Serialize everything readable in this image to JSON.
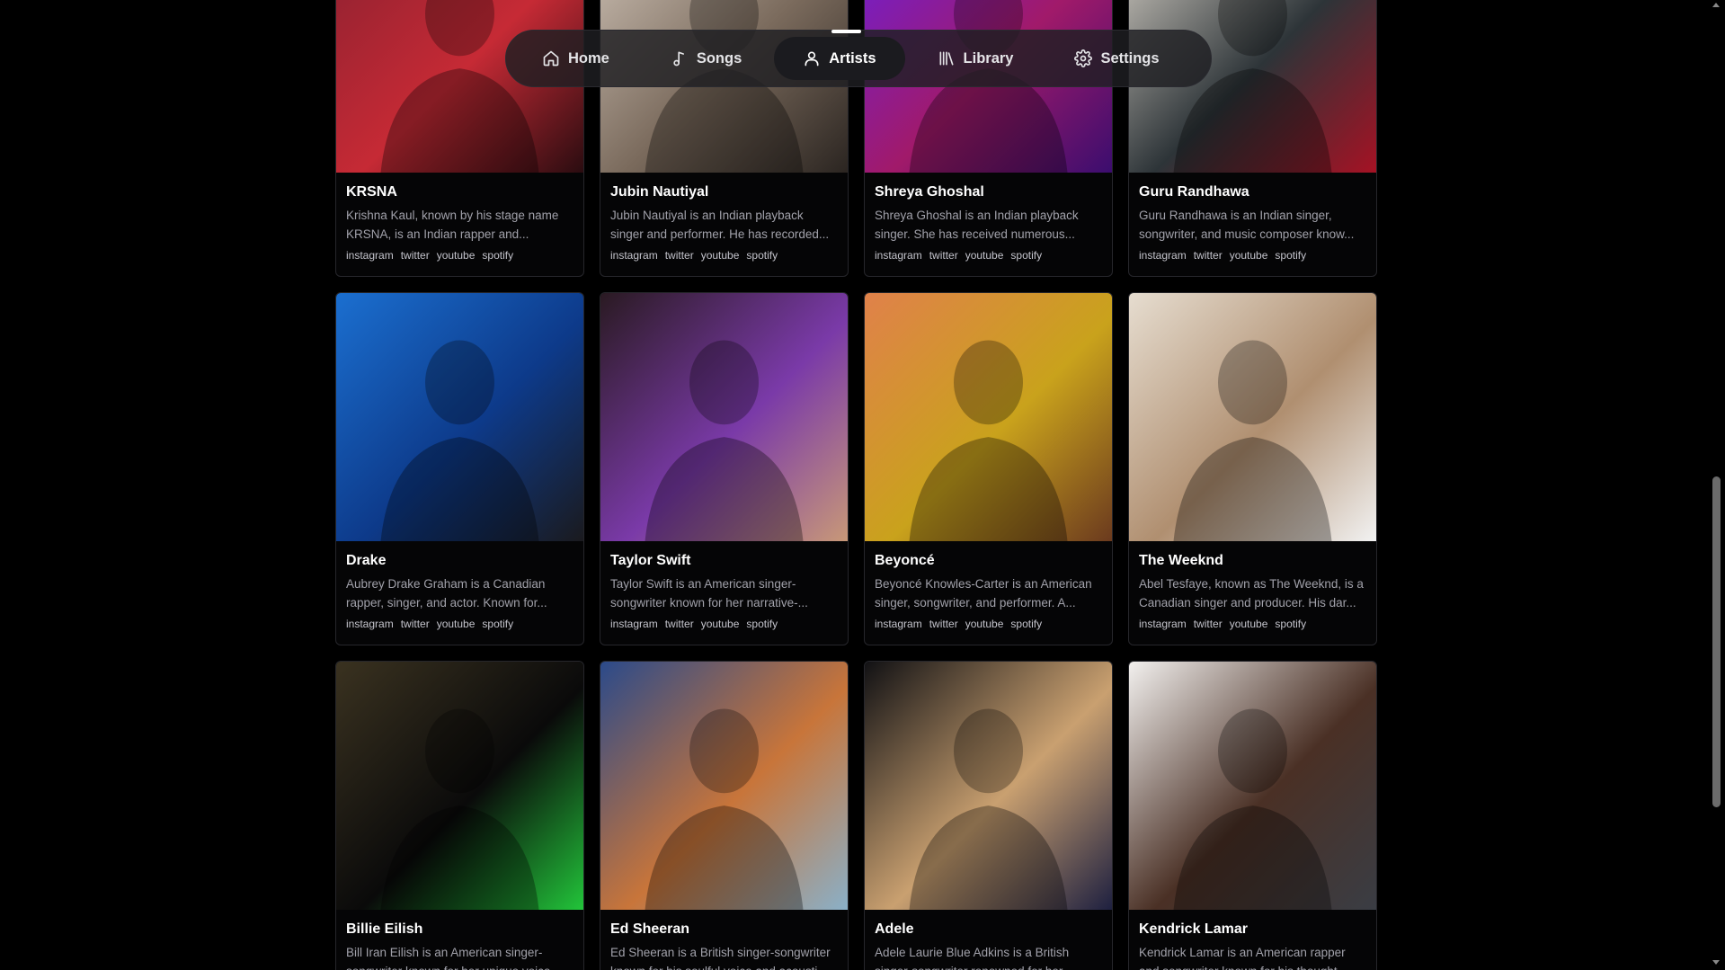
{
  "nav": {
    "items": [
      {
        "label": "Home",
        "icon": "home-icon"
      },
      {
        "label": "Songs",
        "icon": "music-note-icon"
      },
      {
        "label": "Artists",
        "icon": "user-icon",
        "active": true
      },
      {
        "label": "Library",
        "icon": "library-icon"
      },
      {
        "label": "Settings",
        "icon": "gear-icon"
      }
    ]
  },
  "social_links": [
    "instagram",
    "twitter",
    "youtube",
    "spotify"
  ],
  "artists": [
    {
      "name": "KRSNA",
      "description": "Krishna Kaul, known by his stage name KRSNA, is an Indian rapper and...",
      "colors": [
        "#8a2030",
        "#c62a35",
        "#2a0c10"
      ]
    },
    {
      "name": "Jubin Nautiyal",
      "description": "Jubin Nautiyal is an Indian playback singer and performer. He has recorded...",
      "colors": [
        "#cfc3b7",
        "#7a6a5c",
        "#2b2521"
      ]
    },
    {
      "name": "Shreya Ghoshal",
      "description": "Shreya Ghoshal is an Indian playback singer. She has received numerous...",
      "colors": [
        "#6d1fd8",
        "#a11a6a",
        "#3b0d6e"
      ]
    },
    {
      "name": "Guru Randhawa",
      "description": "Guru Randhawa is an Indian singer, songwriter, and music composer know...",
      "colors": [
        "#d8d2c8",
        "#2d3438",
        "#a51224"
      ]
    },
    {
      "name": "Drake",
      "description": "Aubrey Drake Graham is a Canadian rapper, singer, and actor. Known for...",
      "colors": [
        "#1b6fd0",
        "#0d3a8a",
        "#1a1a1e"
      ]
    },
    {
      "name": "Taylor Swift",
      "description": "Taylor Swift is an American singer-songwriter known for her narrative-...",
      "colors": [
        "#2a1a22",
        "#7a3aa8",
        "#c89878"
      ]
    },
    {
      "name": "Beyoncé",
      "description": "Beyoncé Knowles-Carter is an American singer, songwriter, and performer. A...",
      "colors": [
        "#e0814a",
        "#c9a21c",
        "#6b3a1e"
      ]
    },
    {
      "name": "The Weeknd",
      "description": "Abel Tesfaye, known as The Weeknd, is a Canadian singer and producer. His dar...",
      "colors": [
        "#e6ddd0",
        "#b08f70",
        "#f2f2f2"
      ]
    },
    {
      "name": "Billie Eilish",
      "description": "Bill Iran Eilish is an American singer-songwriter known for her unique voice...",
      "colors": [
        "#3a3220",
        "#0a0a0a",
        "#22c43a"
      ]
    },
    {
      "name": "Ed Sheeran",
      "description": "Ed Sheeran is a British singer-songwriter known for his soulful voice and acousti...",
      "colors": [
        "#2b4a8a",
        "#c8753a",
        "#8ab0c8"
      ]
    },
    {
      "name": "Adele",
      "description": "Adele Laurie Blue Adkins is a British singer-songwriter renowned for her...",
      "colors": [
        "#111114",
        "#c9a070",
        "#1e2040"
      ]
    },
    {
      "name": "Kendrick Lamar",
      "description": "Kendrick Lamar is an American rapper and songwriter known for his thought-...",
      "colors": [
        "#f2f0ee",
        "#4a3025",
        "#3a3d44"
      ]
    }
  ]
}
